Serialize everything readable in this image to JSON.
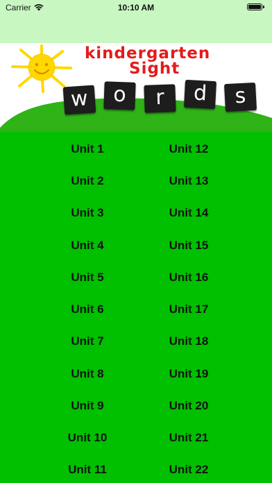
{
  "status_bar": {
    "carrier": "Carrier",
    "time": "10:10 AM",
    "wifi_icon": "wifi-icon",
    "battery_icon": "battery-icon"
  },
  "banner": {
    "title_line1": "kindergarten",
    "title_line2": "Sight",
    "word_tiles": [
      "w",
      "o",
      "r",
      "d",
      "s"
    ],
    "title_color": "#e41b1b",
    "sun_color": "#ffd800",
    "hill_color": "#2fb317"
  },
  "colors": {
    "background": "#00c000",
    "status_bar_bg": "#c9f7c2",
    "unit_text": "#111111"
  },
  "units_left": [
    "Unit 1",
    "Unit 2",
    "Unit 3",
    "Unit 4",
    "Unit 5",
    "Unit 6",
    "Unit 7",
    "Unit 8",
    "Unit 9",
    "Unit 10",
    "Unit 11"
  ],
  "units_right": [
    "Unit 12",
    "Unit 13",
    "Unit 14",
    "Unit 15",
    "Unit 16",
    "Unit 17",
    "Unit 18",
    "Unit 19",
    "Unit 20",
    "Unit 21",
    "Unit 22"
  ]
}
